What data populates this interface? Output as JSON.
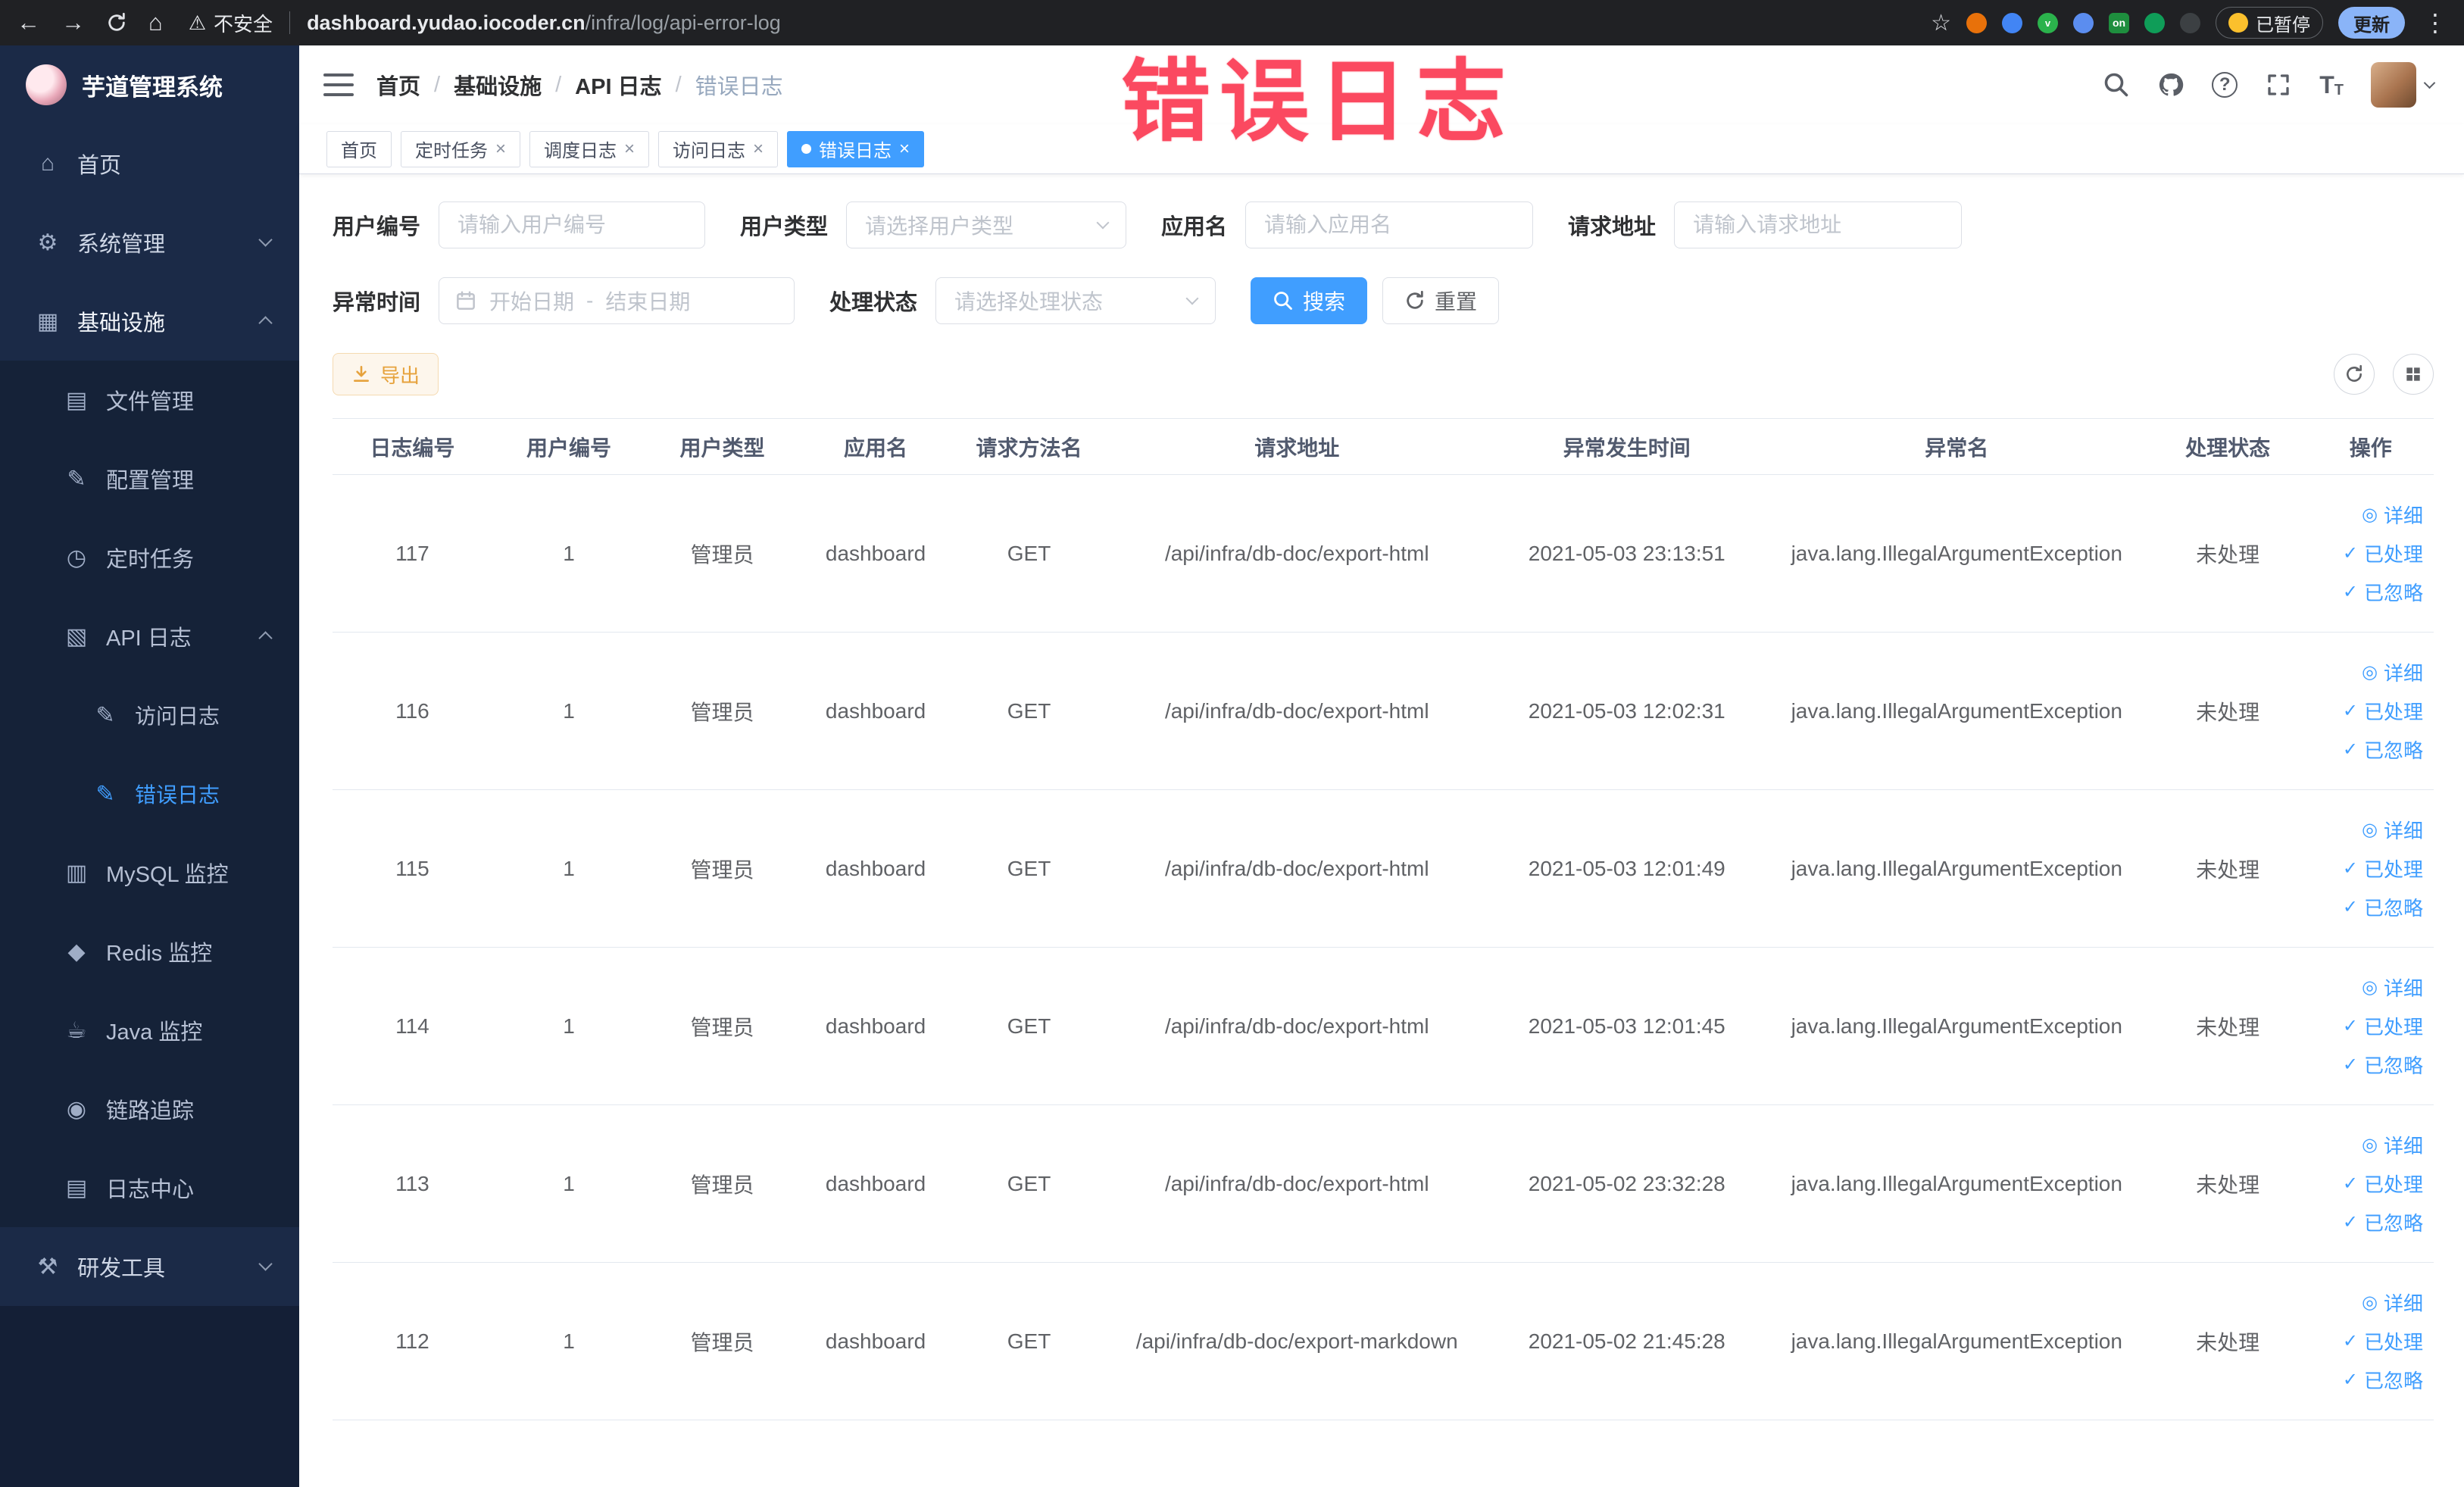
{
  "browser": {
    "security_warning": "不安全",
    "url_domain": "dashboard.yudao.iocoder.cn",
    "url_path": "/infra/log/api-error-log",
    "paused_badge": "已暂停",
    "update_button": "更新"
  },
  "watermark": "错误日志",
  "sidebar": {
    "logo_title": "芋道管理系统",
    "home": "首页",
    "system": "系统管理",
    "infra": "基础设施",
    "file": "文件管理",
    "config": "配置管理",
    "job": "定时任务",
    "api_log": "API 日志",
    "access_log": "访问日志",
    "error_log": "错误日志",
    "mysql": "MySQL 监控",
    "redis": "Redis 监控",
    "java": "Java 监控",
    "trace": "链路追踪",
    "log_center": "日志中心",
    "dev_tools": "研发工具"
  },
  "header": {
    "breadcrumb": [
      "首页",
      "基础设施",
      "API 日志",
      "错误日志"
    ]
  },
  "tabs": [
    {
      "label": "首页"
    },
    {
      "label": "定时任务"
    },
    {
      "label": "调度日志"
    },
    {
      "label": "访问日志"
    },
    {
      "label": "错误日志"
    }
  ],
  "filters": {
    "user_id": {
      "label": "用户编号",
      "placeholder": "请输入用户编号"
    },
    "user_type": {
      "label": "用户类型",
      "placeholder": "请选择用户类型"
    },
    "app_name": {
      "label": "应用名",
      "placeholder": "请输入应用名"
    },
    "request_url": {
      "label": "请求地址",
      "placeholder": "请输入请求地址"
    },
    "exception_time": {
      "label": "异常时间",
      "start_placeholder": "开始日期",
      "separator": "-",
      "end_placeholder": "结束日期"
    },
    "process_status": {
      "label": "处理状态",
      "placeholder": "请选择处理状态"
    },
    "search_button": "搜索",
    "reset_button": "重置"
  },
  "toolbar": {
    "export_button": "导出"
  },
  "table": {
    "columns": [
      "日志编号",
      "用户编号",
      "用户类型",
      "应用名",
      "请求方法名",
      "请求地址",
      "异常发生时间",
      "异常名",
      "处理状态",
      "操作"
    ],
    "row_actions": [
      "详细",
      "已处理",
      "已忽略"
    ],
    "rows": [
      {
        "log_id": "117",
        "user_id": "1",
        "user_type": "管理员",
        "app_name": "dashboard",
        "method": "GET",
        "url": "/api/infra/db-doc/export-html",
        "time": "2021-05-03 23:13:51",
        "exception": "java.lang.IllegalArgumentException",
        "status": "未处理"
      },
      {
        "log_id": "116",
        "user_id": "1",
        "user_type": "管理员",
        "app_name": "dashboard",
        "method": "GET",
        "url": "/api/infra/db-doc/export-html",
        "time": "2021-05-03 12:02:31",
        "exception": "java.lang.IllegalArgumentException",
        "status": "未处理"
      },
      {
        "log_id": "115",
        "user_id": "1",
        "user_type": "管理员",
        "app_name": "dashboard",
        "method": "GET",
        "url": "/api/infra/db-doc/export-html",
        "time": "2021-05-03 12:01:49",
        "exception": "java.lang.IllegalArgumentException",
        "status": "未处理"
      },
      {
        "log_id": "114",
        "user_id": "1",
        "user_type": "管理员",
        "app_name": "dashboard",
        "method": "GET",
        "url": "/api/infra/db-doc/export-html",
        "time": "2021-05-03 12:01:45",
        "exception": "java.lang.IllegalArgumentException",
        "status": "未处理"
      },
      {
        "log_id": "113",
        "user_id": "1",
        "user_type": "管理员",
        "app_name": "dashboard",
        "method": "GET",
        "url": "/api/infra/db-doc/export-html",
        "time": "2021-05-02 23:32:28",
        "exception": "java.lang.IllegalArgumentException",
        "status": "未处理"
      },
      {
        "log_id": "112",
        "user_id": "1",
        "user_type": "管理员",
        "app_name": "dashboard",
        "method": "GET",
        "url": "/api/infra/db-doc/export-markdown",
        "time": "2021-05-02 21:45:28",
        "exception": "java.lang.IllegalArgumentException",
        "status": "未处理"
      }
    ]
  }
}
